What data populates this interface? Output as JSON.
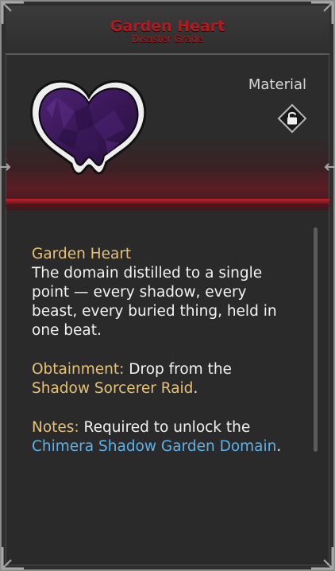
{
  "item": {
    "name": "Garden Heart",
    "grade": "Disaster Grade",
    "type": "Material",
    "icon": "corrupted-purple-heart-icon",
    "lock_icon": "padlock-icon"
  },
  "details": {
    "heading": "Garden Heart",
    "description": "The domain distilled to a single point — every shadow, every beast, every buried thing, held in one beat.",
    "obtainment_label": "Obtainment:",
    "obtainment_text": " Drop from the ",
    "obtainment_source": "Shadow Sorcerer Raid",
    "obtainment_end": ".",
    "notes_label": "Notes:",
    "notes_text": " Required to unlock the ",
    "notes_link": "Chimera Shadow Garden Domain",
    "notes_end": "."
  },
  "colors": {
    "title_red": "#b01b22",
    "highlight_gold": "#e7c276",
    "link_blue": "#5cb2ea",
    "heart_purple": "#3d1a5a"
  }
}
